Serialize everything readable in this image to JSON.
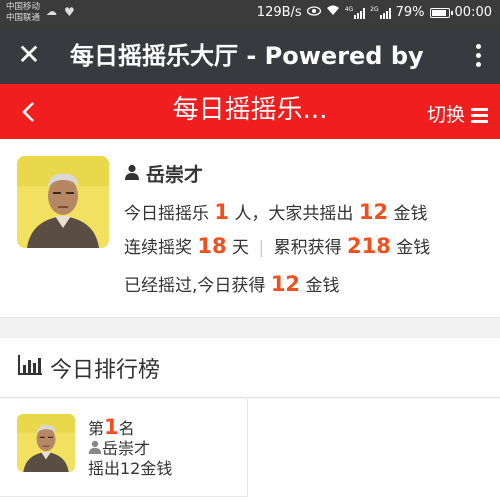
{
  "status_bar": {
    "carrier_1": "中国移动",
    "carrier_2": "中国联通",
    "net_speed": "129B/s",
    "signal_tag_1": "4G",
    "signal_tag_2": "2G",
    "battery": "79%",
    "time": "00:00"
  },
  "browser": {
    "title": "每日摇摇乐大厅 - Powered by",
    "close_icon": "close-icon",
    "more_icon": "more-vertical-icon"
  },
  "app_header": {
    "title": "每日摇摇乐...",
    "switch_label": "切换",
    "bg_color": "#f01e1e"
  },
  "profile": {
    "name": "岳崇才",
    "today_prefix": "今日摇摇乐",
    "today_people": "1",
    "today_mid": "人，大家共摇出",
    "today_total": "12",
    "coin_unit": "金钱",
    "streak_prefix": "连续摇奖",
    "streak_days": "18",
    "streak_unit": "天",
    "accum_prefix": "累积获得",
    "accum_total": "218",
    "shaken_prefix": "已经摇过,今日获得",
    "shaken_amount": "12"
  },
  "ranking": {
    "title": "今日排行榜",
    "entries": [
      {
        "rank_prefix": "第",
        "rank": "1",
        "rank_suffix": "名",
        "name": "岳崇才",
        "result": "摇出12金钱"
      }
    ]
  },
  "colors": {
    "accent_number": "#f0501e",
    "browser_bar": "#393a3f",
    "status_bar": "#3b3b3b"
  }
}
